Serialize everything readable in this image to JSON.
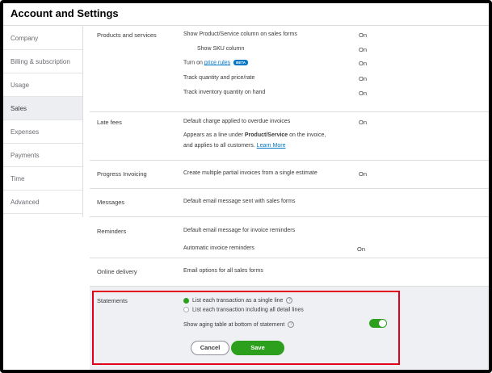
{
  "header": {
    "title": "Account and Settings"
  },
  "sidebar": {
    "items": [
      {
        "label": "Company"
      },
      {
        "label": "Billing & subscription"
      },
      {
        "label": "Usage"
      },
      {
        "label": "Sales"
      },
      {
        "label": "Expenses"
      },
      {
        "label": "Payments"
      },
      {
        "label": "Time"
      },
      {
        "label": "Advanced"
      }
    ],
    "active": "Sales"
  },
  "sections": {
    "products": {
      "title": "Products and services",
      "rows": [
        {
          "label": "Show Product/Service column on sales forms",
          "value": "On"
        },
        {
          "label": "Show SKU column",
          "value": "On"
        },
        {
          "label_prefix": "Turn on ",
          "link": "price rules",
          "badge": "BETA",
          "value": "On"
        },
        {
          "label": "Track quantity and price/rate",
          "value": "On"
        },
        {
          "label": "Track inventory quantity on hand",
          "value": "On"
        }
      ]
    },
    "late_fees": {
      "title": "Late fees",
      "row1": "Default charge applied to overdue invoices",
      "value": "On",
      "desc_prefix": "Appears as a line under ",
      "desc_bold": "Product/Service",
      "desc_suffix": " on the invoice,",
      "desc_line2": "and applies to all customers. ",
      "learn_more": "Learn More"
    },
    "progress": {
      "title": "Progress Invoicing",
      "row": "Create multiple partial invoices from a single estimate",
      "value": "On"
    },
    "messages": {
      "title": "Messages",
      "row": "Default email message sent with sales forms"
    },
    "reminders": {
      "title": "Reminders",
      "row1": "Default email message for invoice reminders",
      "row2": "Automatic invoice reminders",
      "value": "On"
    },
    "online_delivery": {
      "title": "Online delivery",
      "row": "Email options for all sales forms"
    },
    "statements": {
      "title": "Statements",
      "option1": "List each transaction as a single line",
      "option2": "List each transaction including all detail lines",
      "aging": "Show aging table at bottom of statement",
      "help_glyph": "?",
      "aging_enabled": true,
      "cancel_label": "Cancel",
      "save_label": "Save"
    }
  },
  "colors": {
    "accent_green": "#2ca01c",
    "link_blue": "#0077c5",
    "highlight_red": "#e0001b"
  }
}
